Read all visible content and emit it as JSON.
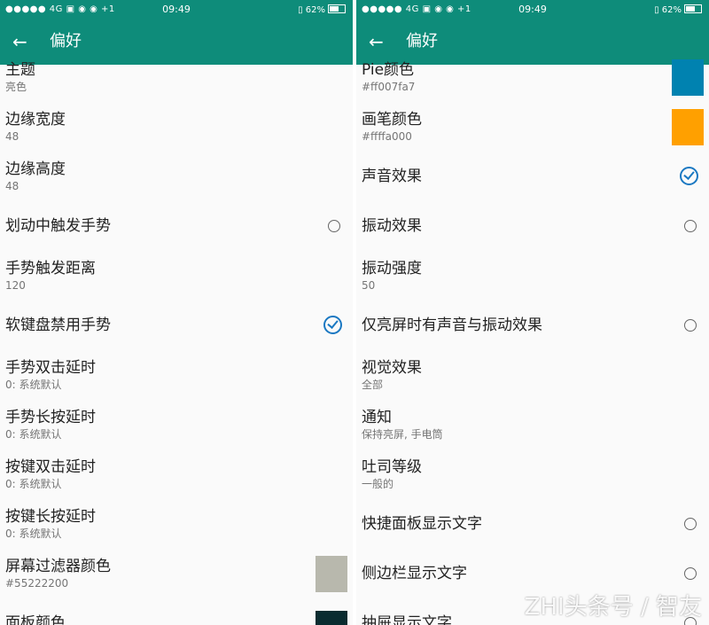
{
  "status": {
    "carrier": "●●●●● 4G ▣ ◉ ◉ +1",
    "time": "09:49",
    "battery": "62%",
    "battery_level": 0.62
  },
  "left": {
    "title": "偏好",
    "items": [
      {
        "title": "主题",
        "subtitle": "亮色"
      },
      {
        "title": "边缘宽度",
        "subtitle": "48"
      },
      {
        "title": "边缘高度",
        "subtitle": "48"
      },
      {
        "title": "划动中触发手势",
        "control": "radio",
        "checked": false
      },
      {
        "title": "手势触发距离",
        "subtitle": "120"
      },
      {
        "title": "软键盘禁用手势",
        "control": "radio",
        "checked": true
      },
      {
        "title": "手势双击延时",
        "subtitle": "0: 系统默认"
      },
      {
        "title": "手势长按延时",
        "subtitle": "0: 系统默认"
      },
      {
        "title": "按键双击延时",
        "subtitle": "0: 系统默认"
      },
      {
        "title": "按键长按延时",
        "subtitle": "0: 系统默认"
      },
      {
        "title": "屏幕过滤器颜色",
        "subtitle": "#55222200",
        "swatch": "#b8b8ad"
      },
      {
        "title": "面板颜色",
        "swatch": "#0a2c30"
      }
    ]
  },
  "right": {
    "title": "偏好",
    "items": [
      {
        "title": "Pie颜色",
        "subtitle": "#ff007fa7",
        "swatch": "#0082b0"
      },
      {
        "title": "画笔颜色",
        "subtitle": "#ffffa000",
        "swatch": "#ffa000"
      },
      {
        "title": "声音效果",
        "control": "radio",
        "checked": true
      },
      {
        "title": "振动效果",
        "control": "radio",
        "checked": false
      },
      {
        "title": "振动强度",
        "subtitle": "50"
      },
      {
        "title": "仅亮屏时有声音与振动效果",
        "control": "radio",
        "checked": false
      },
      {
        "title": "视觉效果",
        "subtitle": "全部"
      },
      {
        "title": "通知",
        "subtitle": "保持亮屏, 手电筒"
      },
      {
        "title": "吐司等级",
        "subtitle": "一般的"
      },
      {
        "title": "快捷面板显示文字",
        "control": "radio",
        "checked": false
      },
      {
        "title": "侧边栏显示文字",
        "control": "radio",
        "checked": false
      },
      {
        "title": "抽屉显示文字",
        "control": "radio",
        "checked": false
      }
    ]
  },
  "watermark": "ZHI头条号 / 智友",
  "colors": {
    "primary": "#0e8c7a",
    "accent": "#1a78c2"
  },
  "icons": {
    "back": "arrow-left-icon"
  }
}
